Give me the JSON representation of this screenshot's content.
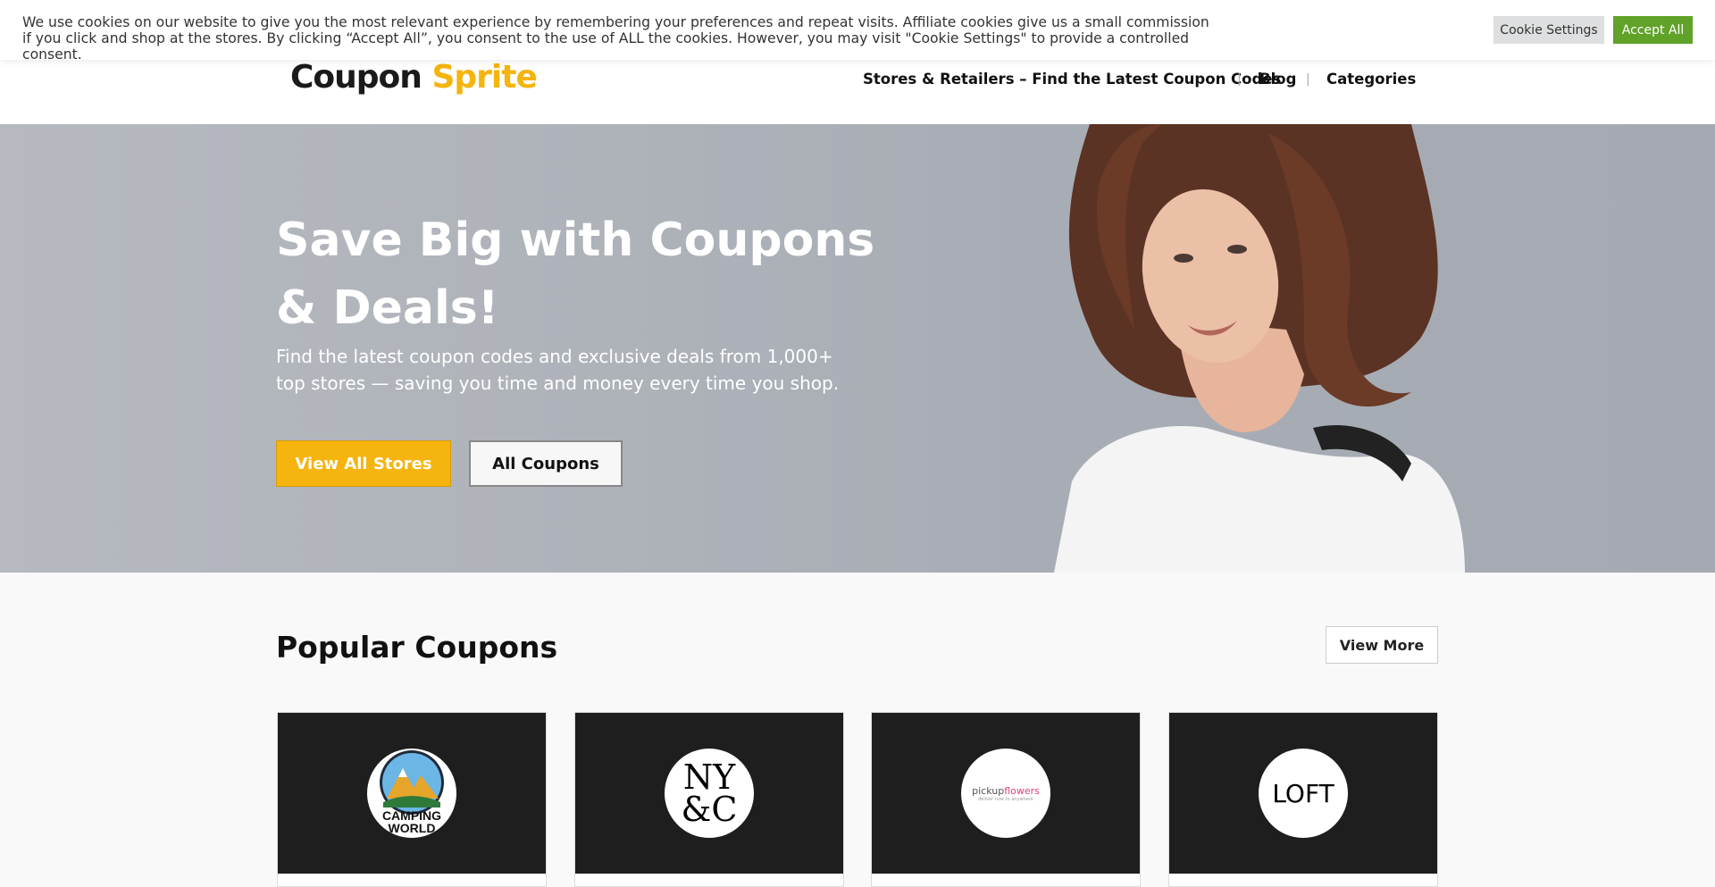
{
  "cookie_bar": {
    "text": "We use cookies on our website to give you the most relevant experience by remembering your preferences and repeat visits. Affiliate cookies give us a small commission if you click and shop at the stores. By clicking “Accept All”, you consent to the use of ALL the cookies. However, you may visit \"Cookie Settings\" to provide a controlled consent.",
    "settings_label": "Cookie Settings",
    "accept_label": "Accept All",
    "accept_color": "#61a229"
  },
  "header": {
    "logo_word1": "Coupon",
    "logo_word2": "Sprite",
    "logo_accent": "#f5b40e",
    "nav": [
      "Stores & Retailers – Find the Latest Coupon Codes",
      "Blog",
      "Categories"
    ],
    "separator": "|"
  },
  "hero": {
    "title": "Save Big with Coupons & Deals!",
    "subtitle": "Find the latest coupon codes and exclusive deals from 1,000+ top stores — saving you time and money every time you shop.",
    "btn_stores": "View All Stores",
    "btn_coupons": "All Coupons"
  },
  "popular": {
    "title": "Popular Coupons",
    "view_more": "View More",
    "cards": [
      {
        "logo_line1": "CAMPING",
        "logo_line2": "WORLD"
      },
      {
        "logo_line1": "NY",
        "logo_line2": "&C"
      },
      {
        "logo_word1": "pickup",
        "logo_word2": "flowers",
        "logo_tagline": "deliver now to anywhere"
      },
      {
        "logo": "LOFT"
      }
    ]
  }
}
